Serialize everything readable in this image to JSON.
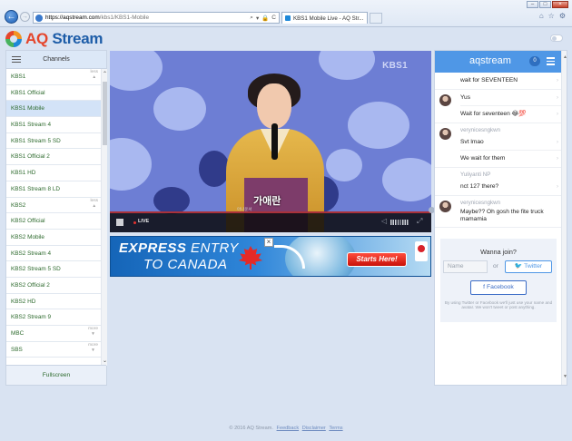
{
  "browser": {
    "address_host": "https://aqstream.com",
    "address_path": "/kbs1/KBS1-Mobile",
    "address_tools": [
      "⌕",
      "▾",
      "🔒",
      "C"
    ],
    "tab_title": "KBS1 Mobile Live - AQ Str...",
    "tab_close": "×",
    "window_buttons": [
      "–",
      "□",
      "×"
    ],
    "chrome_icons": [
      "⌂",
      "☆",
      "⚙"
    ]
  },
  "site": {
    "logo_aq": "AQ",
    "logo_stream": "Stream"
  },
  "channels": {
    "title": "Channels",
    "items": [
      {
        "label": "KBS1",
        "type": "group",
        "toggle": "less",
        "toggle_arrow": "▲"
      },
      {
        "label": "KBS1 Official",
        "type": "item"
      },
      {
        "label": "KBS1 Mobile",
        "type": "item",
        "active": true
      },
      {
        "label": "KBS1 Stream 4",
        "type": "item"
      },
      {
        "label": "KBS1 Stream 5 SD",
        "type": "item"
      },
      {
        "label": "KBS1 Official 2",
        "type": "item"
      },
      {
        "label": "KBS1 HD",
        "type": "item"
      },
      {
        "label": "KBS1 Stream 8 LD",
        "type": "item"
      },
      {
        "label": "KBS2",
        "type": "group",
        "toggle": "less",
        "toggle_arrow": "▲"
      },
      {
        "label": "KBS2 Official",
        "type": "item"
      },
      {
        "label": "KBS2 Mobile",
        "type": "item"
      },
      {
        "label": "KBS2 Stream 4",
        "type": "item"
      },
      {
        "label": "KBS2 Stream 5 SD",
        "type": "item"
      },
      {
        "label": "KBS2 Official 2",
        "type": "item"
      },
      {
        "label": "KBS2 HD",
        "type": "item"
      },
      {
        "label": "KBS2 Stream 9",
        "type": "item"
      },
      {
        "label": "MBC",
        "type": "group",
        "toggle": "more",
        "toggle_arrow": "▼"
      },
      {
        "label": "SBS",
        "type": "group",
        "toggle": "more",
        "toggle_arrow": "▼"
      }
    ],
    "fullscreen_label": "Fullscreen",
    "scroll_up": "⌃",
    "scroll_down": "⌄"
  },
  "video": {
    "channel_bug": "KBS1",
    "caption": "가애란",
    "caption_sub": "아나운서",
    "live_label": "LIVE",
    "volume_icon": "◁",
    "fullscreen_icon": "⤢",
    "colors": {
      "bg": "#6d7ed4",
      "progress": "#a9313a"
    }
  },
  "ad": {
    "line1_bold": "EXPRESS",
    "line1_rest": " ENTRY",
    "line2": "TO CANADA",
    "cta": "Starts Here!",
    "close": "×"
  },
  "chat": {
    "title": "aqstream",
    "count": "0",
    "messages": [
      {
        "avatar": false,
        "user": "",
        "lines": [
          "wait for SEVENTEEN"
        ]
      },
      {
        "avatar": true,
        "user": "",
        "lines": [
          "Yus",
          "Wait for seventeen 😂💯"
        ]
      },
      {
        "avatar": true,
        "user": "verynicesngkwn",
        "lines": [
          "Svt lmao",
          "We wait for them"
        ]
      },
      {
        "avatar": false,
        "user": "Yuliyanti NP",
        "lines": [
          "nct 127 there?"
        ]
      },
      {
        "avatar": true,
        "user": "verynicesngkwn",
        "multiline": "Maybe?? Oh gosh the fite truck mamamia"
      }
    ],
    "caret": "›",
    "join": {
      "title": "Wanna join?",
      "name_placeholder": "Name",
      "or": "or",
      "twitter": "🐦 Twitter",
      "facebook": "f  Facebook",
      "note": "By using Twitter or Facebook we'll just use your name and avatar. We won't tweet or post anything."
    }
  },
  "footer": {
    "copyright": "© 2016 AQ Stream.",
    "links": [
      "Feedback",
      "Disclaimer",
      "Terms"
    ]
  }
}
